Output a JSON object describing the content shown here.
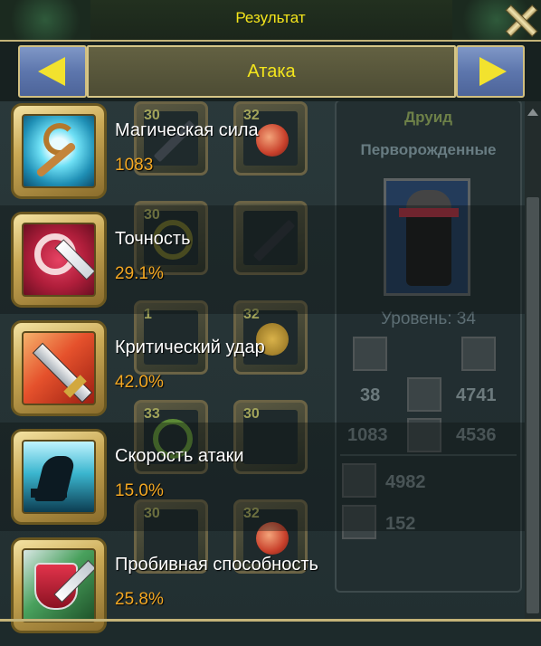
{
  "window": {
    "title": "Результат",
    "close_icon": "close-icon"
  },
  "tabs": {
    "current": "Атака",
    "prev_icon": "arrow-left-icon",
    "next_icon": "arrow-right-icon"
  },
  "stats": [
    {
      "name": "Магическая сила",
      "value": "1083",
      "icon": "magic-staff-icon"
    },
    {
      "name": "Точность",
      "value": "29.1%",
      "icon": "accuracy-target-icon"
    },
    {
      "name": "Критический удар",
      "value": "42.0%",
      "icon": "critical-sword-icon"
    },
    {
      "name": "Скорость атаки",
      "value": "15.0%",
      "icon": "attack-speed-icon"
    },
    {
      "name": "Пробивная способность",
      "value": "25.8%",
      "icon": "penetration-icon"
    }
  ],
  "background_slots": [
    "30",
    "32",
    "30",
    "1",
    "32",
    "33",
    "30",
    "30",
    "32"
  ],
  "character": {
    "class": "Друид",
    "race": "Перворожденные",
    "level": "Уровень: 34",
    "attack": "38",
    "defense": "4741",
    "magic": "1083",
    "magic_defense": "4536",
    "hp": "4982",
    "mana": "152"
  },
  "colors": {
    "title_yellow": "#f5e51b",
    "value_orange": "#f3a722",
    "frame_gold": "#c4b378",
    "arrow_blue": "#5d76ad"
  }
}
